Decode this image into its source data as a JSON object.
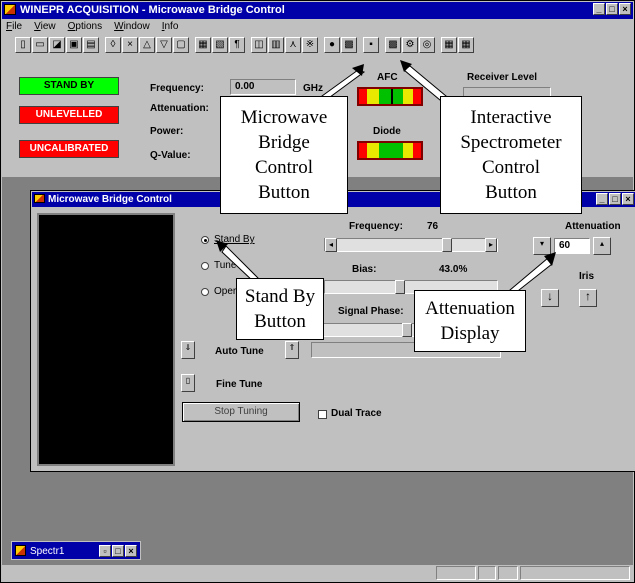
{
  "window": {
    "title": "WINEPR ACQUISITION - Microwave Bridge Control"
  },
  "menu": [
    "File",
    "View",
    "Options",
    "Window",
    "Info"
  ],
  "status": {
    "standby": "STAND BY",
    "unlevelled": "UNLEVELLED",
    "uncalibrated": "UNCALIBRATED",
    "standby_color": "#00ff00",
    "alert_color": "#ff0000"
  },
  "readouts": {
    "frequency_label": "Frequency:",
    "frequency_value": "0.00",
    "frequency_unit": "GHz",
    "attenuation_label": "Attenuation:",
    "power_label": "Power:",
    "qvalue_label": "Q-Value:"
  },
  "meters": {
    "afc_label": "AFC",
    "diode_label": "Diode",
    "receiver_level_label": "Receiver Level"
  },
  "child_window": {
    "title": "Microwave Bridge Control",
    "radio_standby": "Stand By",
    "radio_tune": "Tune",
    "radio_operate": "Operate",
    "frequency_label": "Frequency:",
    "frequency_value": "76",
    "bias_label": "Bias:",
    "bias_value": "43.0%",
    "signal_phase_label": "Signal Phase:",
    "attenuation_label": "Attenuation",
    "attenuation_value": "60",
    "iris_label": "Iris",
    "auto_tune": "Auto Tune",
    "fine_tune": "Fine Tune",
    "stop_tuning": "Stop Tuning",
    "dual_trace": "Dual Trace"
  },
  "minimized": {
    "title": "Spectr1"
  },
  "callouts": {
    "bridge_button": "Microwave\nBridge\nControl\nButton",
    "spectrometer_button": "Interactive\nSpectrometer\nControl\nButton",
    "standby_button": "Stand By\nButton",
    "attenuation_display": "Attenuation\nDisplay"
  }
}
